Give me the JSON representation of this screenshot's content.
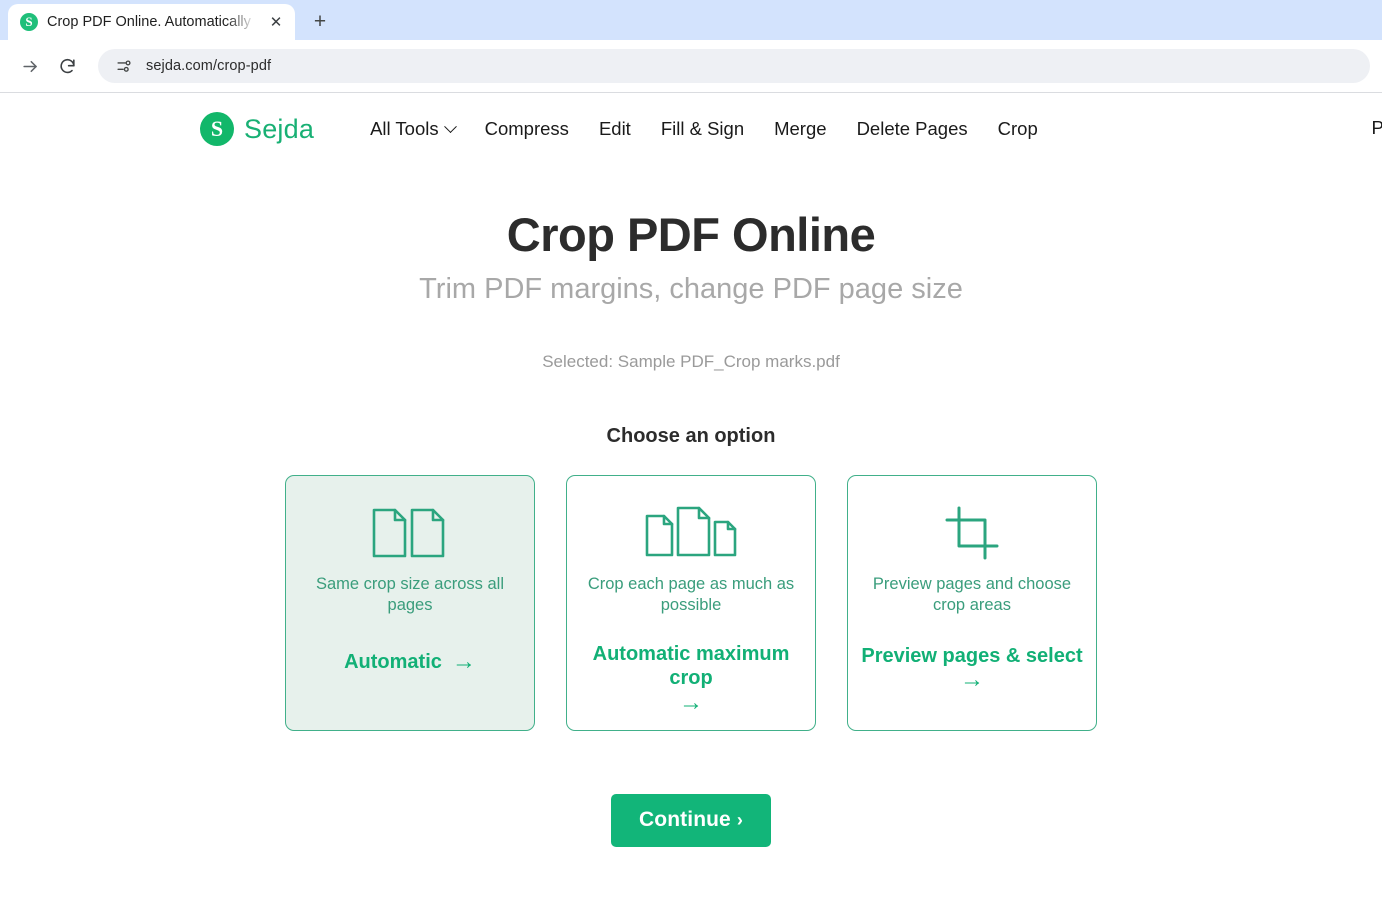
{
  "browser": {
    "tab": {
      "favicon_icon": "sejda-s-favicon",
      "title": "Crop PDF Online. Automatically",
      "close_icon": "close-icon"
    },
    "new_tab_icon": "plus-icon",
    "toolbar": {
      "forward_icon": "arrow-right-icon",
      "reload_icon": "reload-icon",
      "site_info_icon": "site-settings-icon",
      "url": "sejda.com/crop-pdf"
    }
  },
  "site": {
    "brand": {
      "mark": "S",
      "name": "Sejda"
    },
    "nav": [
      {
        "label": "All Tools",
        "has_caret": true
      },
      {
        "label": "Compress",
        "has_caret": false
      },
      {
        "label": "Edit",
        "has_caret": false
      },
      {
        "label": "Fill & Sign",
        "has_caret": false
      },
      {
        "label": "Merge",
        "has_caret": false
      },
      {
        "label": "Delete Pages",
        "has_caret": false
      },
      {
        "label": "Crop",
        "has_caret": false
      }
    ],
    "nav_right_label": "Pr"
  },
  "hero": {
    "title": "Crop PDF Online",
    "subtitle": "Trim PDF margins, change PDF page size",
    "selected_file": "Selected: Sample PDF_Crop marks.pdf"
  },
  "options": {
    "heading": "Choose an option",
    "cards": [
      {
        "id": "automatic",
        "icon": "two-equal-pages-icon",
        "description": "Same crop size across all pages",
        "action": "Automatic",
        "arrow": "→",
        "selected": true
      },
      {
        "id": "automatic-maximum-crop",
        "icon": "three-varied-pages-icon",
        "description": "Crop each page as much as possible",
        "action": "Automatic maximum crop",
        "arrow": "→",
        "selected": false
      },
      {
        "id": "preview-pages-select",
        "icon": "crop-tool-icon",
        "description": "Preview pages and choose crop areas",
        "action": "Preview pages & select",
        "arrow": "→",
        "selected": false
      }
    ]
  },
  "footer_action": {
    "continue_label": "Continue",
    "continue_chevron": "›"
  },
  "colors": {
    "brand_green": "#18b074",
    "accent_green": "#12b076",
    "card_border": "#41b08a",
    "card_selected_bg": "#e7f1ec",
    "desc_text": "#3a9d7c",
    "tab_strip": "#d3e3fd",
    "omnibox_bg": "#eef0f4"
  }
}
